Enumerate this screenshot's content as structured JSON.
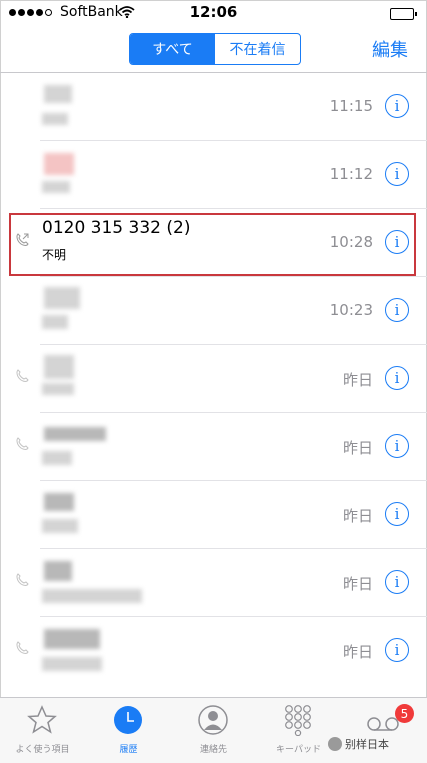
{
  "status_bar": {
    "carrier": "SoftBank",
    "time": "12:06"
  },
  "nav": {
    "segment_all": "すべて",
    "segment_missed": "不在着信",
    "edit_label": "編集"
  },
  "calls": [
    {
      "name": "",
      "subtitle": "",
      "time": "11:15",
      "outgoing": false,
      "blurred": true
    },
    {
      "name": "",
      "subtitle": "",
      "time": "11:12",
      "outgoing": false,
      "blurred": true
    },
    {
      "name": "0120 315 332 (2)",
      "subtitle": "不明",
      "time": "10:28",
      "outgoing": true,
      "blurred": false
    },
    {
      "name": "",
      "subtitle": "",
      "time": "10:23",
      "outgoing": false,
      "blurred": true
    },
    {
      "name": "",
      "subtitle": "",
      "time": "昨日",
      "outgoing": true,
      "blurred": true
    },
    {
      "name": "",
      "subtitle": "",
      "time": "昨日",
      "outgoing": true,
      "blurred": true
    },
    {
      "name": "",
      "subtitle": "",
      "time": "昨日",
      "outgoing": false,
      "blurred": true
    },
    {
      "name": "",
      "subtitle": "",
      "time": "昨日",
      "outgoing": true,
      "blurred": true
    },
    {
      "name": "",
      "subtitle": "",
      "time": "昨日",
      "outgoing": true,
      "blurred": true
    }
  ],
  "info_glyph": "i",
  "tabs": [
    {
      "label": "よく使う項目",
      "icon": "star-icon",
      "active": false
    },
    {
      "label": "履歴",
      "icon": "clock-icon",
      "active": true
    },
    {
      "label": "連絡先",
      "icon": "contact-icon",
      "active": false
    },
    {
      "label": "キーパッド",
      "icon": "keypad-icon",
      "active": false
    },
    {
      "label": "",
      "icon": "voicemail-icon",
      "active": false
    }
  ],
  "voicemail_badge": "5",
  "watermark": "别样日本",
  "colors": {
    "accent": "#1a7cf5",
    "badge": "#f03a3a",
    "highlight": "#c9383d"
  }
}
